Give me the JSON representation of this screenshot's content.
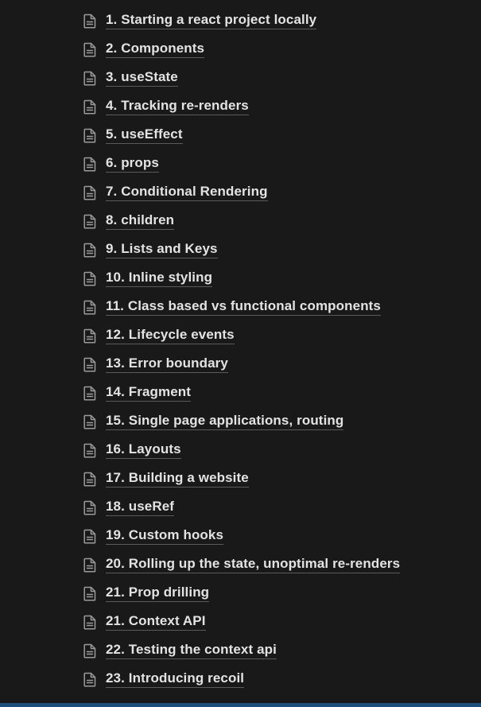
{
  "pages": [
    {
      "label": "1. Starting a react project locally",
      "icon": "page-icon"
    },
    {
      "label": "2. Components",
      "icon": "page-icon"
    },
    {
      "label": "3. useState",
      "icon": "page-icon"
    },
    {
      "label": "4. Tracking re-renders",
      "icon": "page-icon"
    },
    {
      "label": "5. useEffect",
      "icon": "page-icon"
    },
    {
      "label": "6. props",
      "icon": "page-icon"
    },
    {
      "label": "7. Conditional Rendering",
      "icon": "page-icon"
    },
    {
      "label": "8. children",
      "icon": "page-icon"
    },
    {
      "label": "9. Lists and Keys",
      "icon": "page-icon"
    },
    {
      "label": "10. Inline styling",
      "icon": "page-icon"
    },
    {
      "label": "11. Class based vs functional components",
      "icon": "page-icon"
    },
    {
      "label": "12. Lifecycle events",
      "icon": "page-icon"
    },
    {
      "label": "13. Error boundary",
      "icon": "page-icon"
    },
    {
      "label": "14. Fragment",
      "icon": "page-icon"
    },
    {
      "label": "15. Single page applications, routing",
      "icon": "page-icon"
    },
    {
      "label": "16. Layouts",
      "icon": "page-icon"
    },
    {
      "label": "17. Building a website",
      "icon": "page-icon"
    },
    {
      "label": "18. useRef",
      "icon": "page-icon"
    },
    {
      "label": "19. Custom hooks",
      "icon": "page-icon"
    },
    {
      "label": "20. Rolling up the state, unoptimal re-renders",
      "icon": "page-icon"
    },
    {
      "label": "21. Prop drilling",
      "icon": "page-icon"
    },
    {
      "label": "21. Context API",
      "icon": "page-icon"
    },
    {
      "label": "22. Testing the context api",
      "icon": "page-icon"
    },
    {
      "label": "23. Introducing recoil",
      "icon": "page-icon"
    }
  ],
  "colors": {
    "background": "#191919",
    "text": "#e3e3e3",
    "icon": "#9b9b9b",
    "underline": "#5a5a5a",
    "bottom_bar": "#1d4f7c"
  }
}
